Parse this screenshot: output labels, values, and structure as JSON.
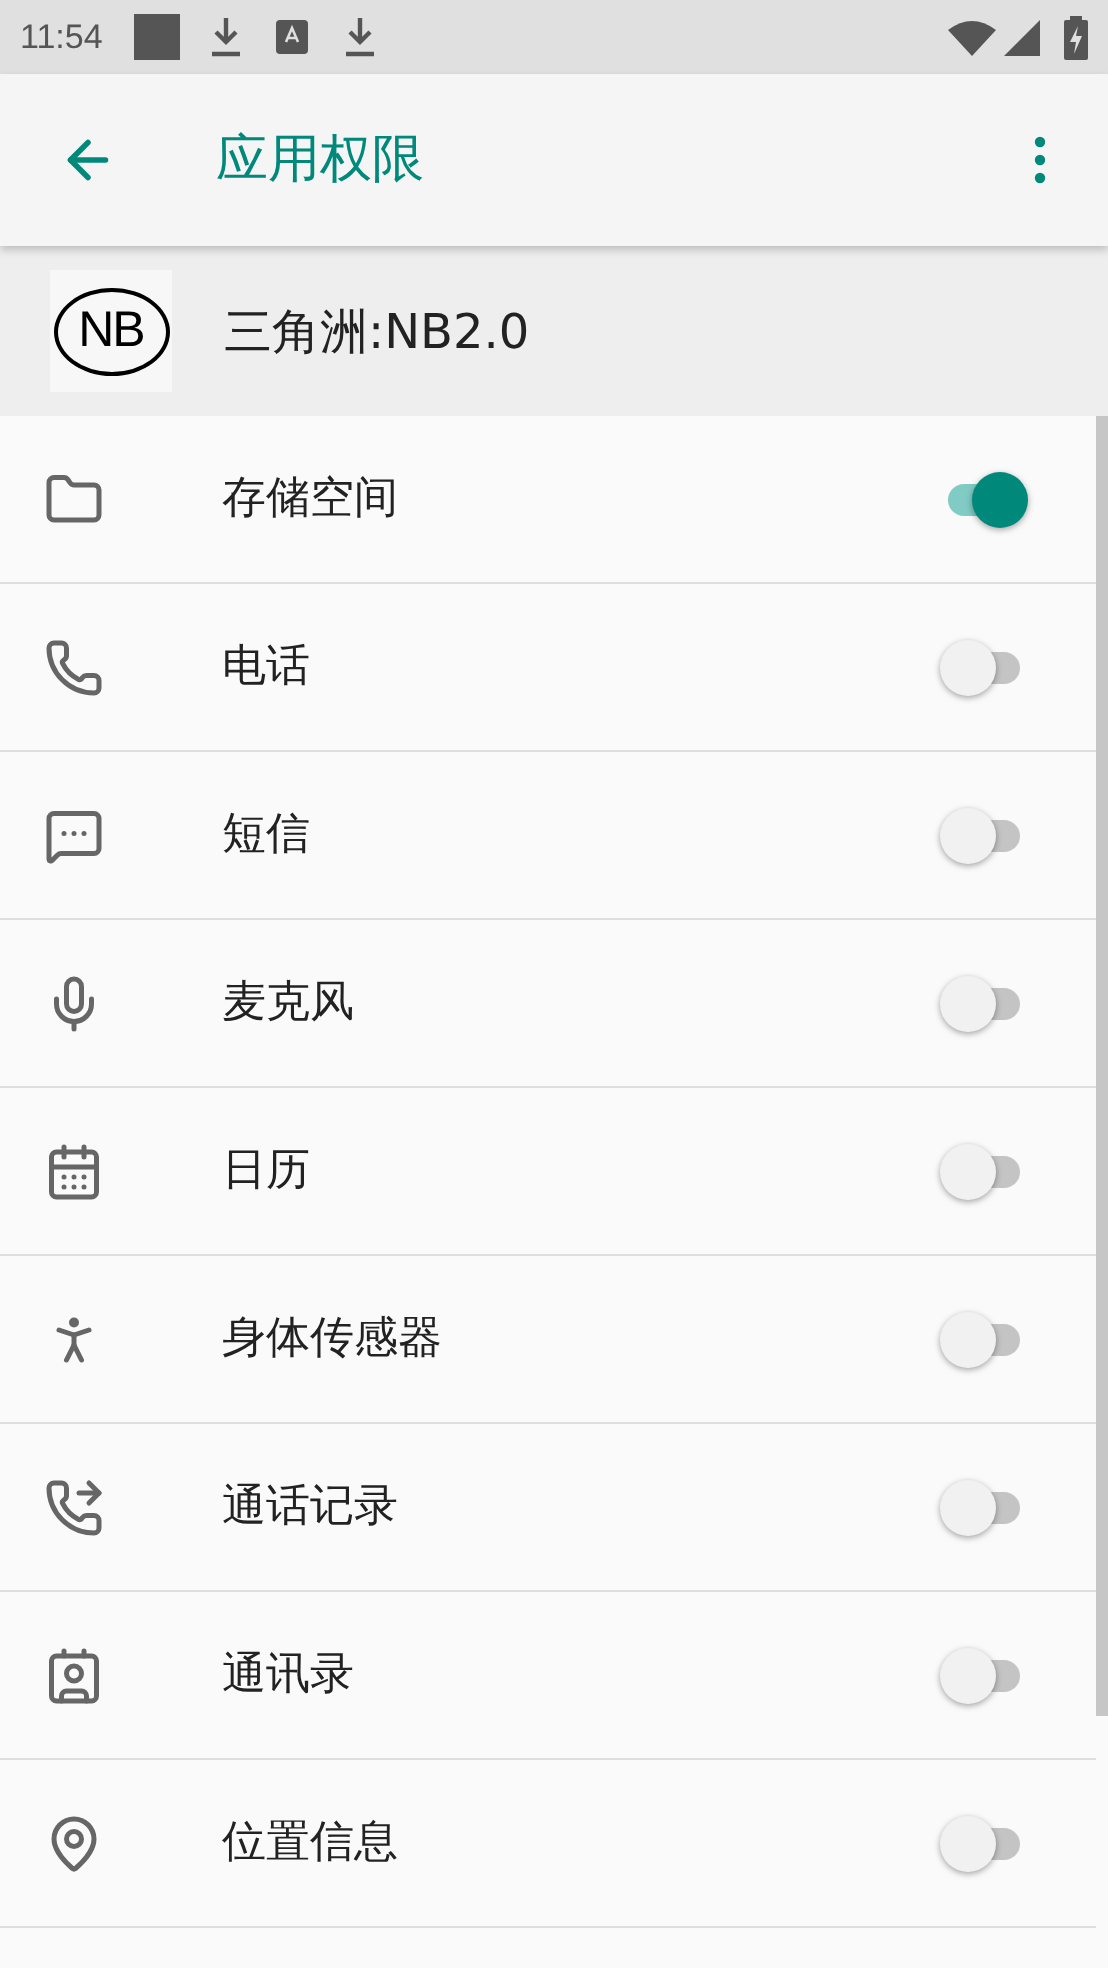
{
  "status_bar": {
    "time": "11:54"
  },
  "toolbar": {
    "title": "应用权限"
  },
  "app": {
    "logo": "NB",
    "name": "三角洲:NB2.0"
  },
  "permissions": [
    {
      "kind": "storage",
      "label": "存储空间",
      "on": true
    },
    {
      "kind": "phone",
      "label": "电话",
      "on": false
    },
    {
      "kind": "sms",
      "label": "短信",
      "on": false
    },
    {
      "kind": "mic",
      "label": "麦克风",
      "on": false
    },
    {
      "kind": "calendar",
      "label": "日历",
      "on": false
    },
    {
      "kind": "sensors",
      "label": "身体传感器",
      "on": false
    },
    {
      "kind": "calllog",
      "label": "通话记录",
      "on": false
    },
    {
      "kind": "contacts",
      "label": "通讯录",
      "on": false
    },
    {
      "kind": "location",
      "label": "位置信息",
      "on": false
    }
  ]
}
